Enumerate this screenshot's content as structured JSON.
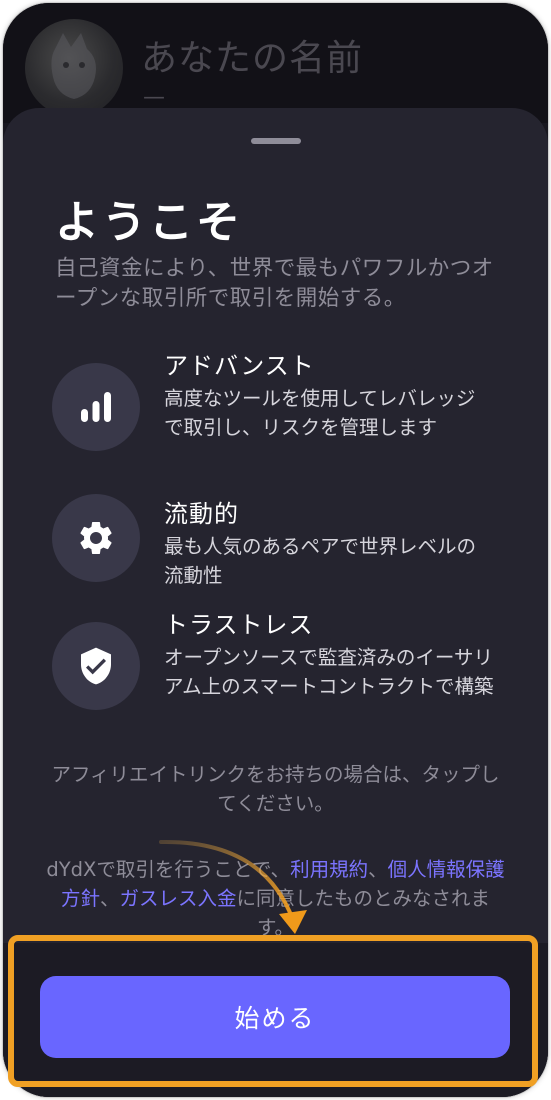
{
  "background": {
    "profile_name": "あなたの名前",
    "profile_sub": "—"
  },
  "sheet": {
    "title": "ようこそ",
    "subtitle": "自己資金により、世界で最もパワフルかつオープンな取引所で取引を開始する。",
    "features": [
      {
        "icon": "bar-chart-icon",
        "title": "アドバンスト",
        "desc": "高度なツールを使用してレバレッジで取引し、リスクを管理します"
      },
      {
        "icon": "gear-icon",
        "title": "流動的",
        "desc": "最も人気のあるペアで世界レベルの流動性"
      },
      {
        "icon": "shield-check-icon",
        "title": "トラストレス",
        "desc": "オープンソースで監査済みのイーサリアム上のスマートコントラクトで構築"
      }
    ],
    "affiliate_text": "アフィリエイトリンクをお持ちの場合は、タップしてください。",
    "terms": {
      "prefix": "dYdXで取引を行うことで、",
      "link1": "利用規約",
      "sep1": "、",
      "link2": "個人情報保護方針",
      "sep2": "、",
      "link3": "ガスレス入金",
      "suffix": "に同意したものとみなされます。"
    },
    "start_button": "始める"
  },
  "colors": {
    "accent": "#6966ff",
    "link": "#7b74ff",
    "highlight": "#f0a024"
  }
}
